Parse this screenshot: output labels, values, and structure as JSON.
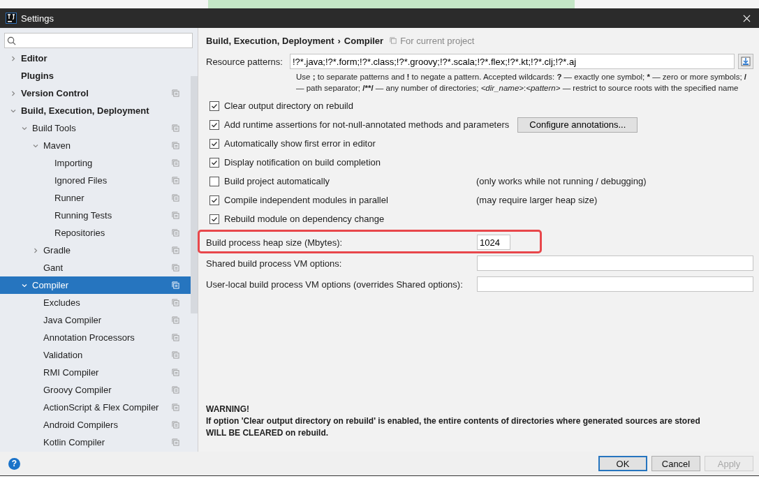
{
  "window": {
    "title": "Settings"
  },
  "help": {
    "label": "?"
  },
  "tree": [
    {
      "label": "Editor",
      "expanded": false,
      "selected": false,
      "project_icon": false
    },
    {
      "label": "Plugins",
      "selected": false,
      "project_icon": false
    },
    {
      "label": "Version Control",
      "expanded": false,
      "selected": false,
      "project_icon": true
    },
    {
      "label": "Build, Execution, Deployment",
      "expanded": true,
      "selected": false,
      "project_icon": false,
      "children": [
        {
          "label": "Build Tools",
          "expanded": true,
          "selected": false,
          "project_icon": true,
          "children": [
            {
              "label": "Maven",
              "expanded": true,
              "selected": false,
              "project_icon": true,
              "children": [
                {
                  "label": "Importing",
                  "selected": false,
                  "project_icon": true
                },
                {
                  "label": "Ignored Files",
                  "selected": false,
                  "project_icon": true
                },
                {
                  "label": "Runner",
                  "selected": false,
                  "project_icon": true
                },
                {
                  "label": "Running Tests",
                  "selected": false,
                  "project_icon": true
                },
                {
                  "label": "Repositories",
                  "selected": false,
                  "project_icon": true
                }
              ]
            },
            {
              "label": "Gradle",
              "expanded": false,
              "selected": false,
              "project_icon": true
            },
            {
              "label": "Gant",
              "selected": false,
              "project_icon": true
            }
          ]
        },
        {
          "label": "Compiler",
          "expanded": true,
          "selected": true,
          "project_icon": true,
          "children": [
            {
              "label": "Excludes",
              "selected": false,
              "project_icon": true
            },
            {
              "label": "Java Compiler",
              "selected": false,
              "project_icon": true
            },
            {
              "label": "Annotation Processors",
              "selected": false,
              "project_icon": true
            },
            {
              "label": "Validation",
              "selected": false,
              "project_icon": true
            },
            {
              "label": "RMI Compiler",
              "selected": false,
              "project_icon": true
            },
            {
              "label": "Groovy Compiler",
              "selected": false,
              "project_icon": true
            },
            {
              "label": "ActionScript & Flex Compiler",
              "selected": false,
              "project_icon": true
            },
            {
              "label": "Android Compilers",
              "selected": false,
              "project_icon": true
            },
            {
              "label": "Kotlin Compiler",
              "selected": false,
              "project_icon": true
            }
          ]
        }
      ]
    }
  ],
  "breadcrumb": {
    "parent": "Build, Execution, Deployment",
    "separator": "›",
    "current": "Compiler",
    "scope": "For current project"
  },
  "resource_patterns": {
    "label": "Resource patterns:",
    "value": "!?*.java;!?*.form;!?*.class;!?*.groovy;!?*.scala;!?*.flex;!?*.kt;!?*.clj;!?*.aj",
    "hint": [
      {
        "kind": "normal",
        "text": "Use "
      },
      {
        "kind": "bold",
        "text": ";"
      },
      {
        "kind": "normal",
        "text": " to separate patterns and "
      },
      {
        "kind": "bold",
        "text": "!"
      },
      {
        "kind": "normal",
        "text": " to negate a pattern. Accepted wildcards: "
      },
      {
        "kind": "bold",
        "text": "?"
      },
      {
        "kind": "normal",
        "text": " — exactly one symbol; "
      },
      {
        "kind": "bold",
        "text": "*"
      },
      {
        "kind": "normal",
        "text": " — zero or more symbols; "
      },
      {
        "kind": "bold",
        "text": "/"
      },
      {
        "kind": "normal",
        "text": " — path separator; "
      },
      {
        "kind": "bold",
        "text": "/**/"
      },
      {
        "kind": "normal",
        "text": " — any number of directories;  "
      },
      {
        "kind": "italic",
        "text": "<dir_name>"
      },
      {
        "kind": "normal",
        "text": ":"
      },
      {
        "kind": "italic",
        "text": "<pattern>"
      },
      {
        "kind": "normal",
        "text": " — restrict to source roots with the specified name"
      }
    ]
  },
  "options": [
    {
      "label": "Clear output directory on rebuild",
      "checked": true
    },
    {
      "label": "Add runtime assertions for not-null-annotated methods and parameters",
      "checked": true,
      "button": "Configure annotations..."
    },
    {
      "label": "Automatically show first error in editor",
      "checked": true
    },
    {
      "label": "Display notification on build completion",
      "checked": true
    },
    {
      "label": "Build project automatically",
      "checked": false,
      "note": "(only works while not running / debugging)"
    },
    {
      "label": "Compile independent modules in parallel",
      "checked": true,
      "note": "(may require larger heap size)"
    },
    {
      "label": "Rebuild module on dependency change",
      "checked": true
    }
  ],
  "fields": [
    {
      "label": "Build process heap size (Mbytes):",
      "value": "1024",
      "kind": "short",
      "highlighted": true
    },
    {
      "label": "Shared build process VM options:",
      "kind": "wide",
      "highlighted": false
    },
    {
      "label": "User-local build process VM options (overrides Shared options):",
      "kind": "wide",
      "highlighted": false
    }
  ],
  "warning": {
    "title": "WARNING!",
    "lines": [
      "If option 'Clear output directory on rebuild' is enabled, the entire contents of directories where generated sources are stored",
      "WILL BE CLEARED on rebuild."
    ]
  },
  "buttons": [
    {
      "label": "OK",
      "kind": "default",
      "disabled": false
    },
    {
      "label": "Cancel",
      "kind": "normal",
      "disabled": false
    },
    {
      "label": "Apply",
      "kind": "normal",
      "disabled": true
    }
  ]
}
